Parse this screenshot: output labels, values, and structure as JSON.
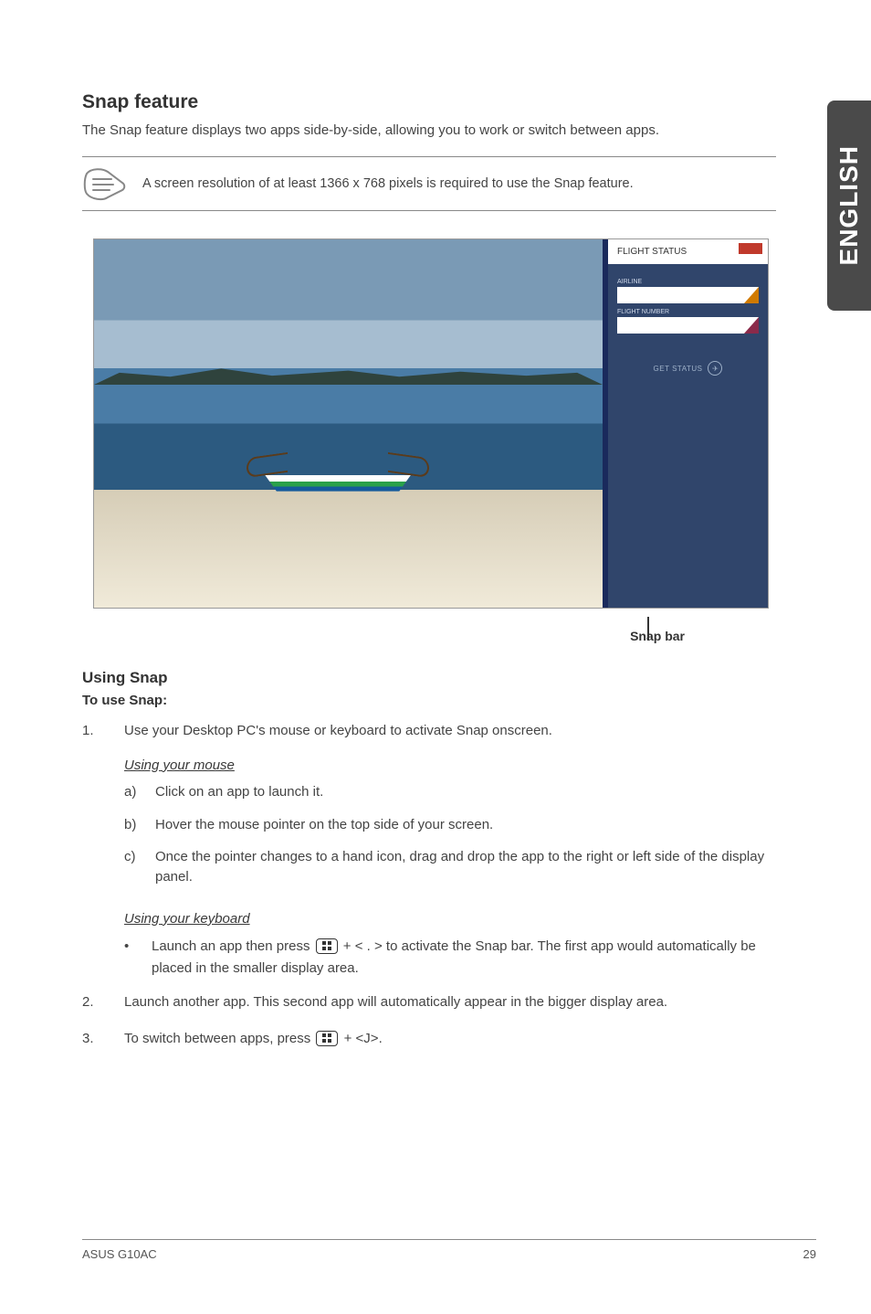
{
  "sideTab": "ENGLISH",
  "title": "Snap feature",
  "intro": "The Snap feature displays two apps side-by-side, allowing you to work or switch between apps.",
  "note": "A screen resolution of at least 1366 x 768 pixels is required to use the Snap feature.",
  "screenshot": {
    "flightStatus": {
      "title": "FLIGHT STATUS",
      "field1_label": "AIRLINE",
      "field2_label": "FLIGHT NUMBER",
      "button": "GET STATUS",
      "buttonIcon": "✈"
    }
  },
  "snapBarLabel": "Snap bar",
  "usingTitle": "Using Snap",
  "toUse": "To use Snap:",
  "step1": "Use your Desktop PC's mouse or keyboard to activate Snap onscreen.",
  "mouseHeading": "Using your mouse",
  "mouse_a": "Click on an app to launch it.",
  "mouse_b": "Hover the mouse pointer on the top side of your screen.",
  "mouse_c": "Once the pointer changes to a hand icon, drag and drop the app to the right or left side of the display panel.",
  "kbHeading": "Using your keyboard",
  "kb_bullet_pre": "Launch an app then press ",
  "kb_bullet_mid": " + < . > to activate the Snap bar. The first app would automatically be placed in the smaller display area.",
  "step2": "Launch another app. This second app will automatically appear in the bigger display area.",
  "step3_pre": "To switch between apps, press ",
  "step3_post": " + <J>.",
  "footer_left": "ASUS G10AC",
  "footer_right": "29"
}
